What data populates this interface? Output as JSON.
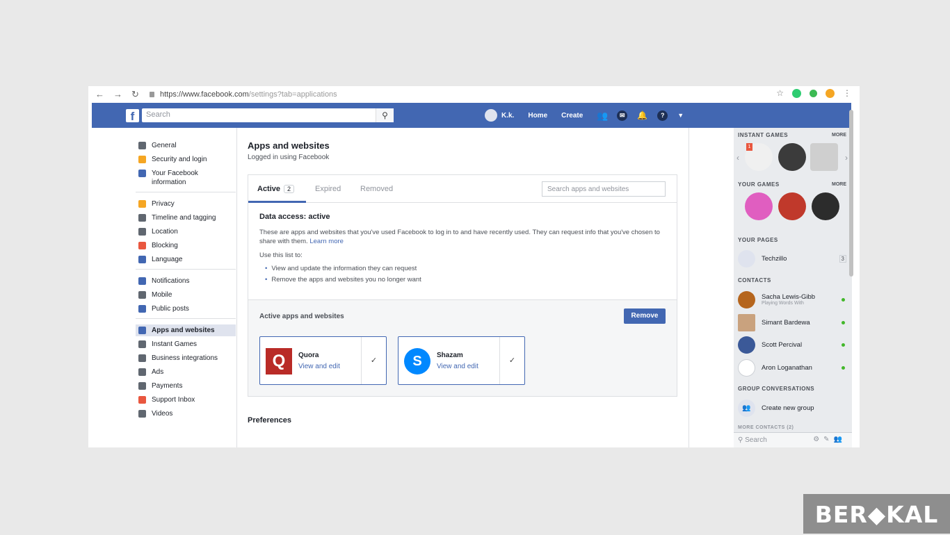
{
  "browser": {
    "url_domain": "https://www.facebook.com",
    "url_path": "/settings?tab=applications"
  },
  "fb_header": {
    "logo": "f",
    "search_placeholder": "Search",
    "user_name": "K.k.",
    "home_label": "Home",
    "create_label": "Create"
  },
  "left_nav": {
    "group1": [
      {
        "label": "General",
        "icon": "gear-icon",
        "color": "#606770"
      },
      {
        "label": "Security and login",
        "icon": "lock-icon",
        "color": "#f5a623"
      },
      {
        "label": "Your Facebook information",
        "icon": "facebook-icon",
        "color": "#4267b2"
      }
    ],
    "group2": [
      {
        "label": "Privacy",
        "icon": "lock-icon",
        "color": "#f5a623"
      },
      {
        "label": "Timeline and tagging",
        "icon": "timeline-icon",
        "color": "#606770"
      },
      {
        "label": "Location",
        "icon": "location-icon",
        "color": "#606770"
      },
      {
        "label": "Blocking",
        "icon": "blocking-icon",
        "color": "#e9573f"
      },
      {
        "label": "Language",
        "icon": "language-icon",
        "color": "#4267b2"
      }
    ],
    "group3": [
      {
        "label": "Notifications",
        "icon": "globe-icon",
        "color": "#4267b2"
      },
      {
        "label": "Mobile",
        "icon": "mobile-icon",
        "color": "#606770"
      },
      {
        "label": "Public posts",
        "icon": "rss-icon",
        "color": "#4267b2"
      }
    ],
    "group4": [
      {
        "label": "Apps and websites",
        "icon": "apps-icon",
        "color": "#4267b2",
        "selected": true
      },
      {
        "label": "Instant Games",
        "icon": "game-icon",
        "color": "#606770"
      },
      {
        "label": "Business integrations",
        "icon": "business-icon",
        "color": "#606770"
      },
      {
        "label": "Ads",
        "icon": "ads-icon",
        "color": "#606770"
      },
      {
        "label": "Payments",
        "icon": "payment-icon",
        "color": "#606770"
      },
      {
        "label": "Support Inbox",
        "icon": "support-icon",
        "color": "#e9573f"
      },
      {
        "label": "Videos",
        "icon": "video-icon",
        "color": "#606770"
      }
    ]
  },
  "main": {
    "title": "Apps and websites",
    "subtitle": "Logged in using Facebook",
    "tabs": {
      "active_label": "Active",
      "active_count": "2",
      "expired_label": "Expired",
      "removed_label": "Removed"
    },
    "search_placeholder": "Search apps and websites",
    "data_access": {
      "heading": "Data access: active",
      "desc": "These are apps and websites that you've used Facebook to log in to and have recently used. They can request info that you've chosen to share with them. ",
      "learn_more": "Learn more",
      "use_heading": "Use this list to:",
      "use_items": [
        "View and update the information they can request",
        "Remove the apps and websites you no longer want"
      ]
    },
    "active_apps": {
      "label": "Active apps and websites",
      "remove_label": "Remove",
      "apps": [
        {
          "name": "Quora",
          "edit": "View and edit",
          "icon_letter": "Q",
          "color": "#b92b27"
        },
        {
          "name": "Shazam",
          "edit": "View and edit",
          "icon_letter": "S",
          "color": "#0088ff"
        }
      ]
    },
    "preferences_label": "Preferences"
  },
  "right_sidebar": {
    "instant_games": "INSTANT GAMES",
    "more": "MORE",
    "instant_badge": "1",
    "your_games": "YOUR GAMES",
    "your_games_more": "MORE",
    "your_pages": "YOUR PAGES",
    "page_name": "Techzillo",
    "page_count": "3",
    "contacts": "CONTACTS",
    "contact_list": [
      {
        "name": "Sacha Lewis-Gibb",
        "status": "Playing Words With",
        "color": "#b5651d"
      },
      {
        "name": "Simant Bardewa",
        "status": "",
        "color": "#c9a27e"
      },
      {
        "name": "Scott Percival",
        "status": "",
        "color": "#3b5998"
      },
      {
        "name": "Aron Loganathan",
        "status": "",
        "color": "#dfe3ee"
      }
    ],
    "group_conv": "GROUP CONVERSATIONS",
    "create_group": "Create new group",
    "more_contacts": "MORE CONTACTS (2)",
    "search_placeholder": "Search"
  },
  "watermark": "BER◆KAL"
}
